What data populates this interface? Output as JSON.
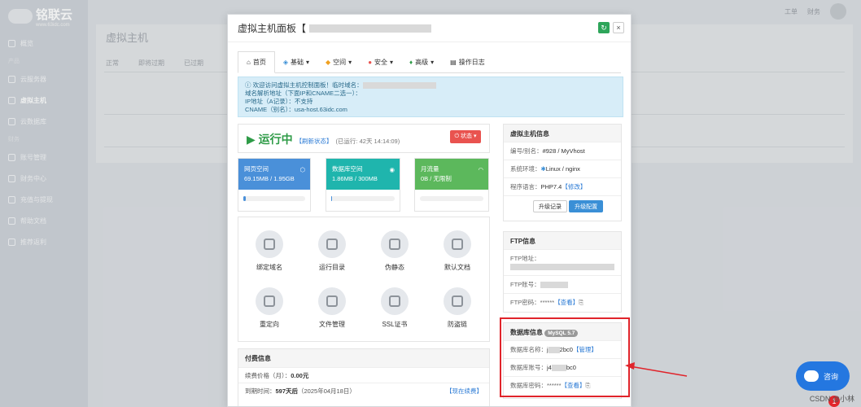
{
  "brand": {
    "name": "铭联云",
    "sub": "www.63idc.com"
  },
  "sidebar": {
    "items": [
      "概览",
      "云服务器",
      "虚拟主机",
      "云数据库"
    ],
    "group": "财务",
    "items2": [
      "账号管理",
      "财务中心",
      "充值与提现",
      "帮助文档",
      "推荐返利"
    ],
    "group_top": "产品"
  },
  "topbar": {
    "items": [
      "工单",
      "财务"
    ]
  },
  "background": {
    "title": "虚拟主机",
    "tabs": [
      "正常",
      "即将过期",
      "已过期"
    ]
  },
  "modal": {
    "title": "虚拟主机面板【",
    "tabs": [
      "首页",
      "基础",
      "空间",
      "安全",
      "高级",
      "操作日志"
    ],
    "notice": [
      "欢迎访问虚拟主机控制面板！临时域名：",
      "域名解析地址（下面IP和CNAME二选一）：",
      "IP地址（A记录）：不支持",
      "CNAME（别名）：usa-host.63idc.com"
    ],
    "status": {
      "label": "运行中",
      "refresh": "【刷新状态】",
      "uptime": "(已运行: 42天 14:14:09)",
      "button": "状态"
    },
    "cards": [
      {
        "title": "网页空间",
        "value": "69.15MB / 1.95GB",
        "color": "#4a90d9",
        "fill": 0.04
      },
      {
        "title": "数据库空间",
        "value": "1.86MB / 300MB",
        "color": "#1fb5ad",
        "fill": 0.01
      },
      {
        "title": "月流量",
        "value": "0B / 无限制",
        "color": "#5cb85c",
        "fill": 0.0
      }
    ],
    "tools": [
      "绑定域名",
      "运行目录",
      "伪静态",
      "默认文档",
      "重定向",
      "文件管理",
      "SSL证书",
      "防盗链"
    ],
    "fee": {
      "title": "付费信息",
      "price_label": "续费价格（月）：",
      "price": "0.00元",
      "expire_label": "到期时间：",
      "expire": "597天后",
      "expire_date": "（2025年04月18日）",
      "renew": "【现在续费】"
    },
    "host": {
      "title": "虚拟主机信息",
      "id_label": "编号/别名：",
      "id": "#928 / MyVhost",
      "env_label": "系统环境：",
      "env": "Linux / nginx",
      "lang_label": "程序语言：",
      "lang": "PHP7.4",
      "modify": "【修改】",
      "btn1": "升级记录",
      "btn2": "升级配置"
    },
    "ftp": {
      "title": "FTP信息",
      "addr": "FTP地址：",
      "acct": "FTP账号：",
      "pwd": "FTP密码：",
      "mask": "******",
      "view": "【查看】"
    },
    "db": {
      "title": "数据库信息",
      "badge": "MySQL 5.7",
      "name_label": "数据库名称：",
      "name_pre": "j",
      "name": "2bc0",
      "manage": "【管理】",
      "acct_label": "数据库账号：",
      "acct_pre": "j4",
      "acct": "bc0",
      "pwd_label": "数据库密码：",
      "mask": "******",
      "view": "【查看】"
    }
  },
  "consult": {
    "label": "咨询",
    "badge": "1"
  },
  "watermark": "CSDN @小林"
}
